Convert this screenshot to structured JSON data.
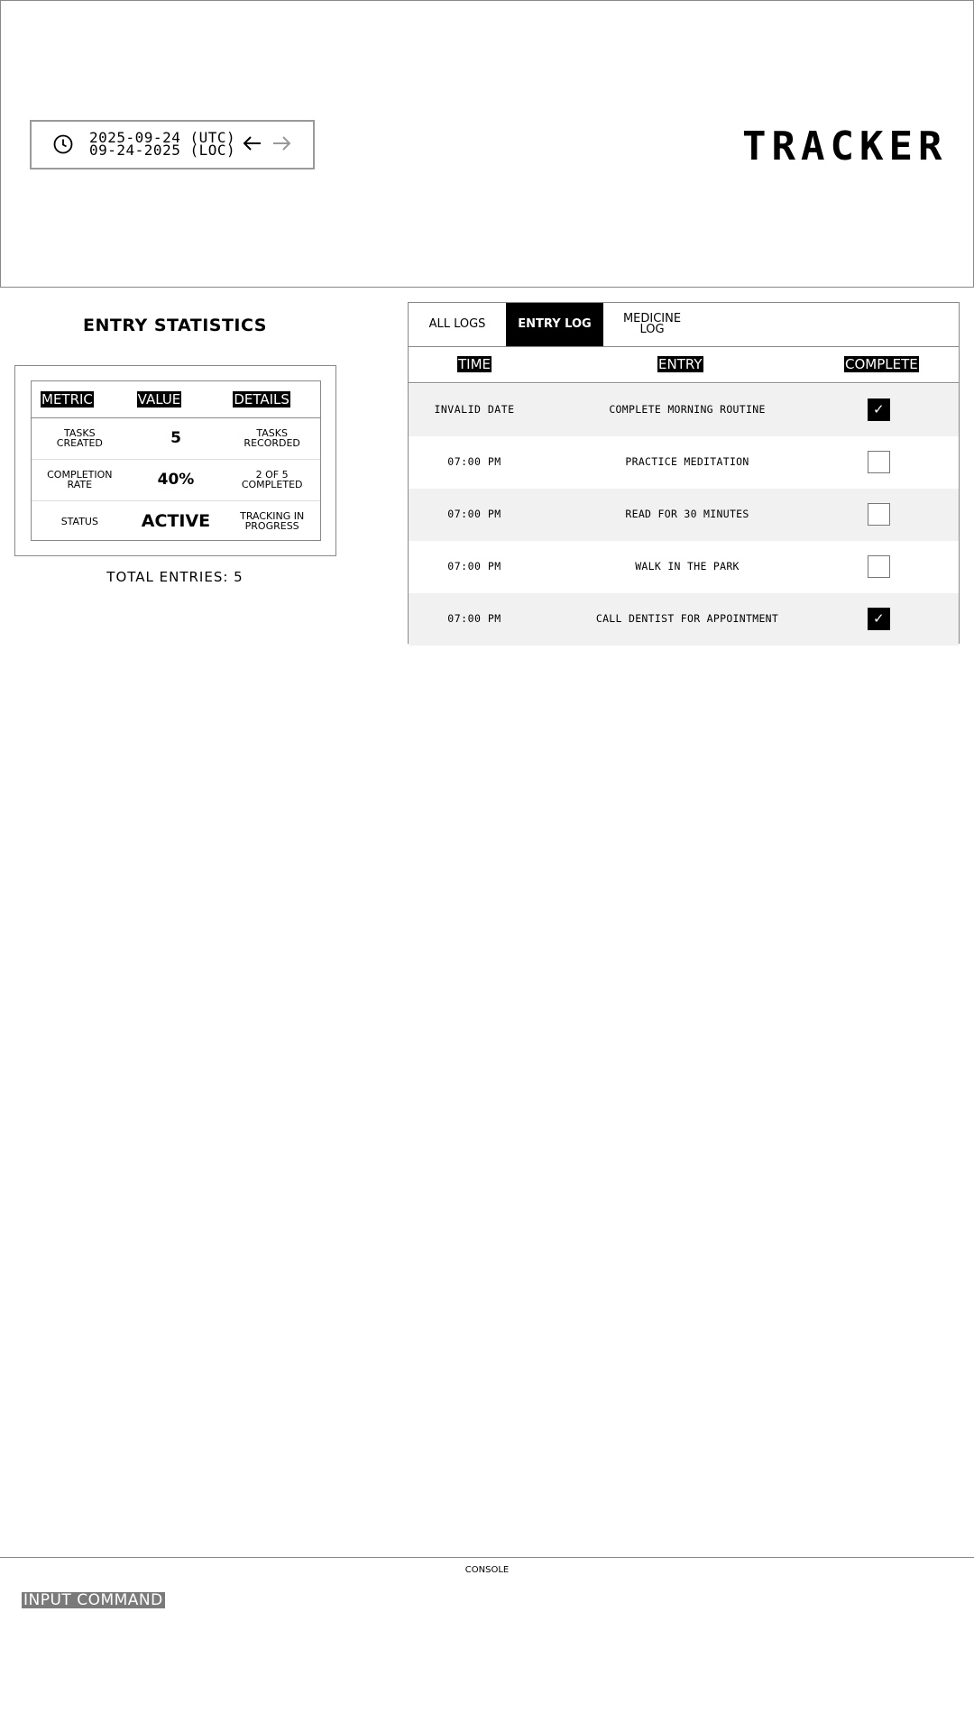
{
  "header": {
    "date_utc": "2025-09-24 (UTC)",
    "date_loc": "09-24-2025 (LOC)",
    "brand": "TRACKER",
    "icons": {
      "clock": "clock-icon",
      "prev": "arrow-left-icon",
      "next": "arrow-right-icon"
    }
  },
  "stats": {
    "title": "ENTRY STATISTICS",
    "columns": [
      "METRIC",
      "VALUE",
      "DETAILS"
    ],
    "rows": [
      {
        "metric": "TASKS\nCREATED",
        "value": "5",
        "details": "TASKS\nRECORDED"
      },
      {
        "metric": "COMPLETION\nRATE",
        "value": "40%",
        "details": "2 OF 5\nCOMPLETED"
      },
      {
        "metric": "STATUS",
        "value": "ACTIVE",
        "details": "TRACKING IN\nPROGRESS"
      }
    ],
    "total": "TOTAL ENTRIES: 5"
  },
  "log": {
    "tabs": [
      "ALL LOGS",
      "ENTRY LOG",
      "MEDICINE\nLOG"
    ],
    "active_tab": 1,
    "columns": [
      "TIME",
      "ENTRY",
      "COMPLETE"
    ],
    "rows": [
      {
        "time": "INVALID DATE",
        "entry": "COMPLETE MORNING ROUTINE",
        "complete": true
      },
      {
        "time": "07:00 PM",
        "entry": "PRACTICE MEDITATION",
        "complete": false
      },
      {
        "time": "07:00 PM",
        "entry": "READ FOR 30 MINUTES",
        "complete": false
      },
      {
        "time": "07:00 PM",
        "entry": "WALK IN THE PARK",
        "complete": false
      },
      {
        "time": "07:00 PM",
        "entry": "CALL DENTIST FOR APPOINTMENT",
        "complete": true
      }
    ]
  },
  "console": {
    "label": "CONSOLE",
    "input_placeholder": "INPUT COMMAND"
  }
}
